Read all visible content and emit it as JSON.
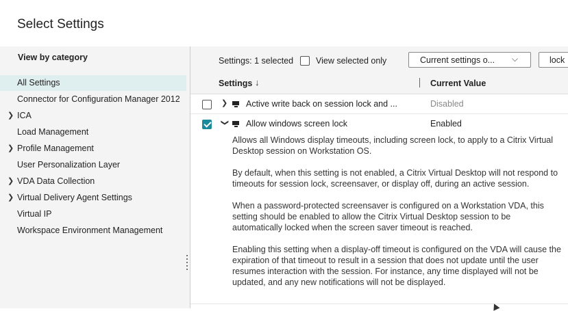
{
  "header": {
    "title": "Select Settings"
  },
  "sidebar": {
    "heading": "View by category",
    "items": [
      {
        "label": "All Settings",
        "expandable": false,
        "selected": true
      },
      {
        "label": "Connector for Configuration Manager 2012",
        "expandable": false,
        "selected": false
      },
      {
        "label": "ICA",
        "expandable": true,
        "selected": false
      },
      {
        "label": "Load Management",
        "expandable": false,
        "selected": false
      },
      {
        "label": "Profile Management",
        "expandable": true,
        "selected": false
      },
      {
        "label": "User Personalization Layer",
        "expandable": false,
        "selected": false
      },
      {
        "label": "VDA Data Collection",
        "expandable": true,
        "selected": false
      },
      {
        "label": "Virtual Delivery Agent Settings",
        "expandable": true,
        "selected": false
      },
      {
        "label": "Virtual IP",
        "expandable": false,
        "selected": false
      },
      {
        "label": "Workspace Environment Management",
        "expandable": false,
        "selected": false
      }
    ]
  },
  "toolbar": {
    "selected_count": "Settings: 1 selected",
    "view_selected_label": "View selected only",
    "view_selected_checked": false,
    "filter_value": "Current settings o...",
    "search_value": "lock"
  },
  "columns": {
    "settings": "Settings",
    "current_value": "Current Value"
  },
  "rows": [
    {
      "name": "Active write back on session lock and ...",
      "value": "Disabled",
      "checked": false,
      "expanded": false
    },
    {
      "name": "Allow windows screen lock",
      "value": "Enabled",
      "checked": true,
      "expanded": true,
      "description": [
        "Allows all Windows display timeouts, including screen lock, to apply to a Citrix Virtual Desktop session on Workstation OS.",
        "By default, when this setting is not enabled, a Citrix Virtual Desktop will not respond to timeouts for session lock, screensaver, or display off, during an active session.",
        "When a password-protected screensaver is configured on a Workstation VDA, this setting should be enabled to allow the Citrix Virtual Desktop session to be automatically locked when the screen saver timeout is reached.",
        "Enabling this setting when a display-off timeout is configured on the VDA will cause the expiration of that timeout to result in a session that does not update until the user resumes interaction with the session. For instance, any time displayed will not be updated, and any new notifications will not be displayed."
      ]
    }
  ],
  "icons": {
    "expand": "chevron-right-icon",
    "collapse": "chevron-down-icon",
    "sort": "arrow-down-icon",
    "row_type": "monitor-icon",
    "dropdown": "chevron-down-icon",
    "resize": "vertical-grip-icon"
  },
  "colors": {
    "accent": "#1b8a9c",
    "selected_bg": "#dfeeef",
    "panel_bg": "#f4f4f4"
  }
}
